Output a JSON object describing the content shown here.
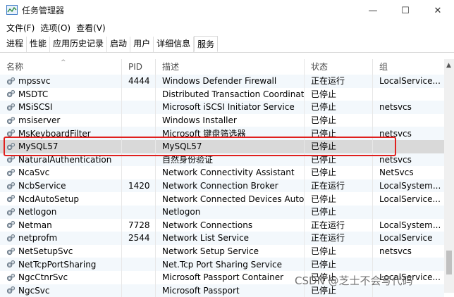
{
  "window": {
    "title": "任务管理器",
    "minimize": "—",
    "maximize": "☐",
    "close": "✕"
  },
  "menu": [
    "文件(F)",
    "选项(O)",
    "查看(V)"
  ],
  "tabs": [
    "进程",
    "性能",
    "应用历史记录",
    "启动",
    "用户",
    "详细信息",
    "服务"
  ],
  "active_tab": "服务",
  "columns": {
    "name": "名称",
    "pid": "PID",
    "desc": "描述",
    "status": "状态",
    "group": "组"
  },
  "rows": [
    {
      "name": "mpssvc",
      "pid": "4444",
      "desc": "Windows Defender Firewall",
      "status": "正在运行",
      "group": "LocalService..."
    },
    {
      "name": "MSDTC",
      "pid": "",
      "desc": "Distributed Transaction Coordinat...",
      "status": "已停止",
      "group": ""
    },
    {
      "name": "MSiSCSI",
      "pid": "",
      "desc": "Microsoft iSCSI Initiator Service",
      "status": "已停止",
      "group": "netsvcs"
    },
    {
      "name": "msiserver",
      "pid": "",
      "desc": "Windows Installer",
      "status": "已停止",
      "group": ""
    },
    {
      "name": "MsKeyboardFilter",
      "pid": "",
      "desc": "Microsoft 键盘筛选器",
      "status": "已停止",
      "group": "netsvcs"
    },
    {
      "name": "MySQL57",
      "pid": "",
      "desc": "MySQL57",
      "status": "已停止",
      "group": ""
    },
    {
      "name": "NaturalAuthentication",
      "pid": "",
      "desc": "自然身份验证",
      "status": "已停止",
      "group": "netsvcs"
    },
    {
      "name": "NcaSvc",
      "pid": "",
      "desc": "Network Connectivity Assistant",
      "status": "已停止",
      "group": "NetSvcs"
    },
    {
      "name": "NcbService",
      "pid": "1420",
      "desc": "Network Connection Broker",
      "status": "正在运行",
      "group": "LocalSystem..."
    },
    {
      "name": "NcdAutoSetup",
      "pid": "",
      "desc": "Network Connected Devices Auto...",
      "status": "已停止",
      "group": "LocalService..."
    },
    {
      "name": "Netlogon",
      "pid": "",
      "desc": "Netlogon",
      "status": "已停止",
      "group": ""
    },
    {
      "name": "Netman",
      "pid": "7728",
      "desc": "Network Connections",
      "status": "正在运行",
      "group": "LocalSystem..."
    },
    {
      "name": "netprofm",
      "pid": "2544",
      "desc": "Network List Service",
      "status": "正在运行",
      "group": "LocalService"
    },
    {
      "name": "NetSetupSvc",
      "pid": "",
      "desc": "Network Setup Service",
      "status": "已停止",
      "group": "netsvcs"
    },
    {
      "name": "NetTcpPortSharing",
      "pid": "",
      "desc": "Net.Tcp Port Sharing Service",
      "status": "已停止",
      "group": ""
    },
    {
      "name": "NgcCtnrSvc",
      "pid": "",
      "desc": "Microsoft Passport Container",
      "status": "已停止",
      "group": "LocalService..."
    },
    {
      "name": "NgcSvc",
      "pid": "",
      "desc": "Microsoft Passport",
      "status": "已停止",
      "group": ""
    }
  ],
  "selected_row": 5,
  "watermark": "CSDN @芝士不会写代码",
  "colors": {
    "highlight": "#e0201e",
    "selected": "#d9d9d9",
    "alt_row": "#f3f8fc"
  }
}
